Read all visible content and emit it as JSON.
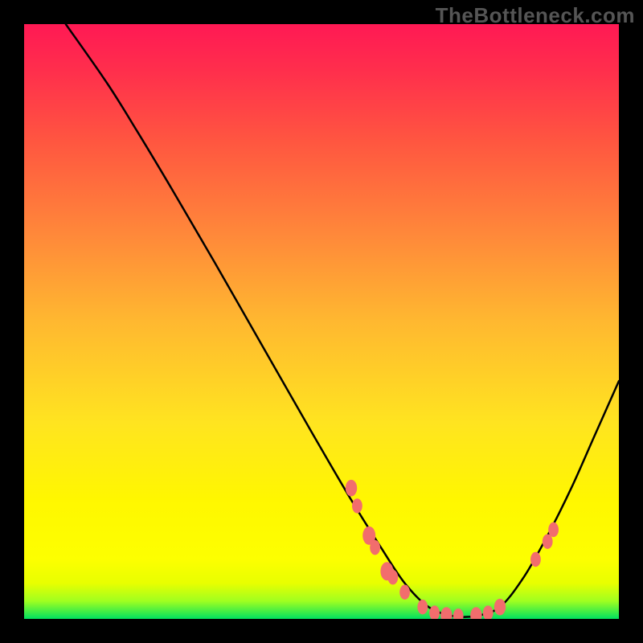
{
  "watermark": "TheBottleneck.com",
  "colors": {
    "marker": "#f26d6d",
    "curve": "#000000",
    "background_stops": [
      "#ff1954",
      "#ff2f4c",
      "#ff5740",
      "#ff873a",
      "#ffb830",
      "#ffe420",
      "#fff700",
      "#fdff00",
      "#e8ff00",
      "#a0ff20",
      "#00e060"
    ]
  },
  "chart_data": {
    "type": "line",
    "title": "",
    "xlabel": "",
    "ylabel": "",
    "xlim": [
      0,
      100
    ],
    "ylim": [
      0,
      100
    ],
    "curve": [
      {
        "x": 7,
        "y": 100
      },
      {
        "x": 14,
        "y": 90
      },
      {
        "x": 19,
        "y": 82
      },
      {
        "x": 25,
        "y": 72
      },
      {
        "x": 32,
        "y": 60
      },
      {
        "x": 40,
        "y": 46
      },
      {
        "x": 48,
        "y": 32
      },
      {
        "x": 55,
        "y": 20
      },
      {
        "x": 60,
        "y": 12
      },
      {
        "x": 64,
        "y": 6
      },
      {
        "x": 68,
        "y": 2
      },
      {
        "x": 72,
        "y": 0.5
      },
      {
        "x": 76,
        "y": 0.5
      },
      {
        "x": 80,
        "y": 2
      },
      {
        "x": 84,
        "y": 7
      },
      {
        "x": 88,
        "y": 14
      },
      {
        "x": 92,
        "y": 22
      },
      {
        "x": 96,
        "y": 31
      },
      {
        "x": 100,
        "y": 40
      }
    ],
    "markers": [
      {
        "x": 55,
        "y": 22,
        "r": 9
      },
      {
        "x": 56,
        "y": 19,
        "r": 8
      },
      {
        "x": 58,
        "y": 14,
        "r": 10
      },
      {
        "x": 59,
        "y": 12,
        "r": 8
      },
      {
        "x": 61,
        "y": 8,
        "r": 10
      },
      {
        "x": 62,
        "y": 7,
        "r": 8
      },
      {
        "x": 64,
        "y": 4.5,
        "r": 8
      },
      {
        "x": 67,
        "y": 2,
        "r": 8
      },
      {
        "x": 69,
        "y": 1,
        "r": 8
      },
      {
        "x": 71,
        "y": 0.6,
        "r": 9
      },
      {
        "x": 73,
        "y": 0.5,
        "r": 8
      },
      {
        "x": 76,
        "y": 0.6,
        "r": 9
      },
      {
        "x": 78,
        "y": 1,
        "r": 8
      },
      {
        "x": 80,
        "y": 2,
        "r": 9
      },
      {
        "x": 86,
        "y": 10,
        "r": 8
      },
      {
        "x": 88,
        "y": 13,
        "r": 8
      },
      {
        "x": 89,
        "y": 15,
        "r": 8
      }
    ]
  }
}
